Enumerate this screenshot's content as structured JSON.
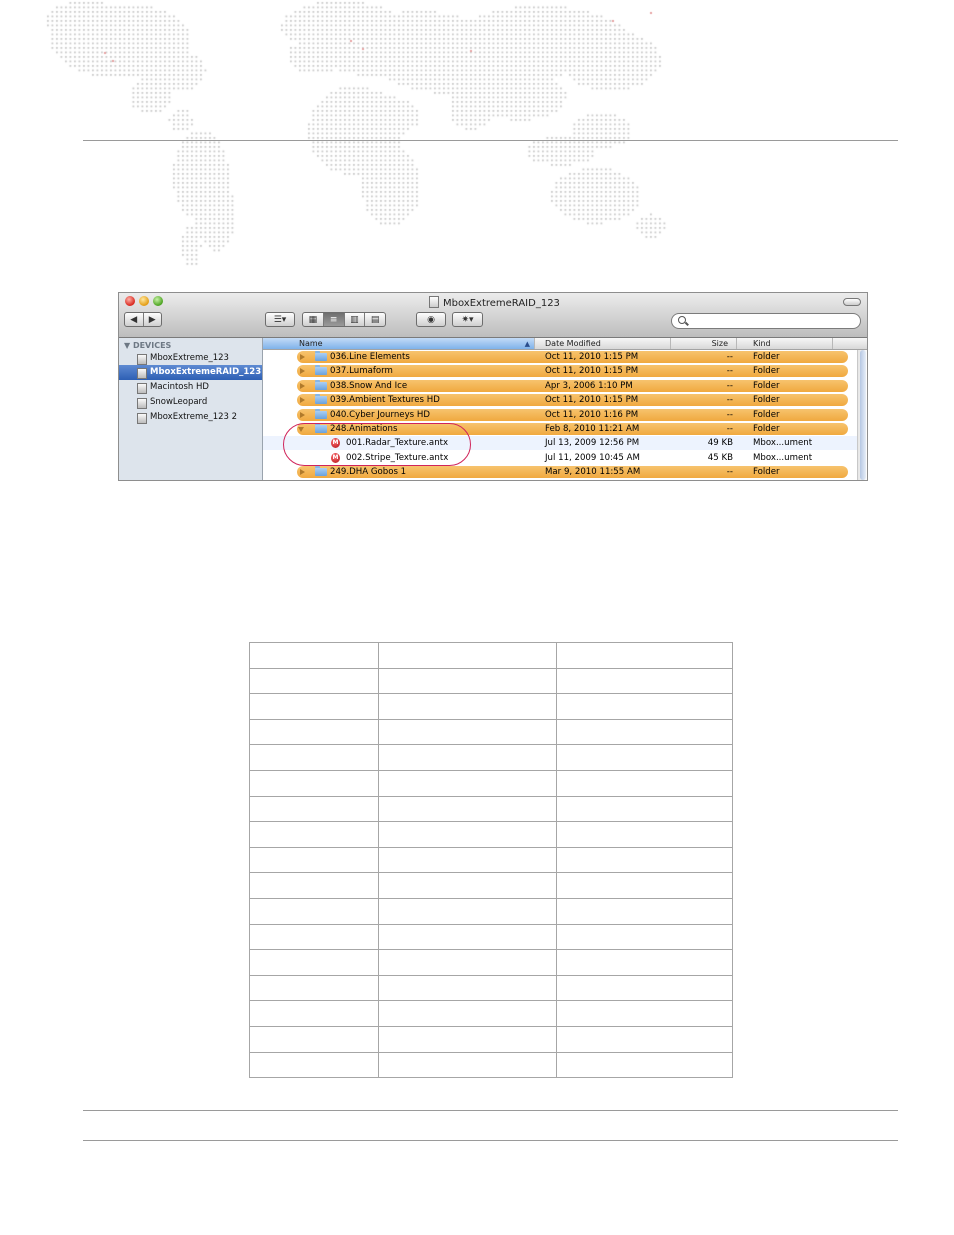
{
  "window": {
    "title": "MboxExtremeRAID_123"
  },
  "sidebar": {
    "heading": "▼ DEVICES",
    "items": [
      {
        "label": "MboxExtreme_123",
        "selected": false
      },
      {
        "label": "MboxExtremeRAID_123",
        "selected": true
      },
      {
        "label": "Macintosh HD",
        "selected": false
      },
      {
        "label": "SnowLeopard",
        "selected": false
      },
      {
        "label": "MboxExtreme_123 2",
        "selected": false
      }
    ]
  },
  "columns": {
    "name": "Name",
    "date": "Date Modified",
    "size": "Size",
    "kind": "Kind"
  },
  "rows": [
    {
      "name": "036.Line Elements",
      "date": "Oct 11, 2010 1:15 PM",
      "size": "--",
      "kind": "Folder",
      "type": "folder"
    },
    {
      "name": "037.Lumaform",
      "date": "Oct 11, 2010 1:15 PM",
      "size": "--",
      "kind": "Folder",
      "type": "folder"
    },
    {
      "name": "038.Snow And Ice",
      "date": "Apr 3, 2006 1:10 PM",
      "size": "--",
      "kind": "Folder",
      "type": "folder"
    },
    {
      "name": "039.Ambient Textures HD",
      "date": "Oct 11, 2010 1:15 PM",
      "size": "--",
      "kind": "Folder",
      "type": "folder"
    },
    {
      "name": "040.Cyber Journeys HD",
      "date": "Oct 11, 2010 1:16 PM",
      "size": "--",
      "kind": "Folder",
      "type": "folder"
    },
    {
      "name": "248.Animations",
      "date": "Feb 8, 2010 11:21 AM",
      "size": "--",
      "kind": "Folder",
      "type": "folder-open"
    },
    {
      "name": "001.Radar_Texture.antx",
      "date": "Jul 13, 2009 12:56 PM",
      "size": "49 KB",
      "kind": "Mbox...ument",
      "type": "file"
    },
    {
      "name": "002.Stripe_Texture.antx",
      "date": "Jul 11, 2009 10:45 AM",
      "size": "45 KB",
      "kind": "Mbox...ument",
      "type": "file"
    },
    {
      "name": "249.DHA Gobos 1",
      "date": "Mar 9, 2010 11:55 AM",
      "size": "--",
      "kind": "Folder",
      "type": "folder"
    }
  ],
  "file_icon_glyph": "M",
  "colors": {
    "folder_row": "#f0a93f",
    "selection": "#2d5fb4",
    "oval": "#d0245a"
  },
  "table": {
    "rows": 17,
    "cols": 3
  }
}
